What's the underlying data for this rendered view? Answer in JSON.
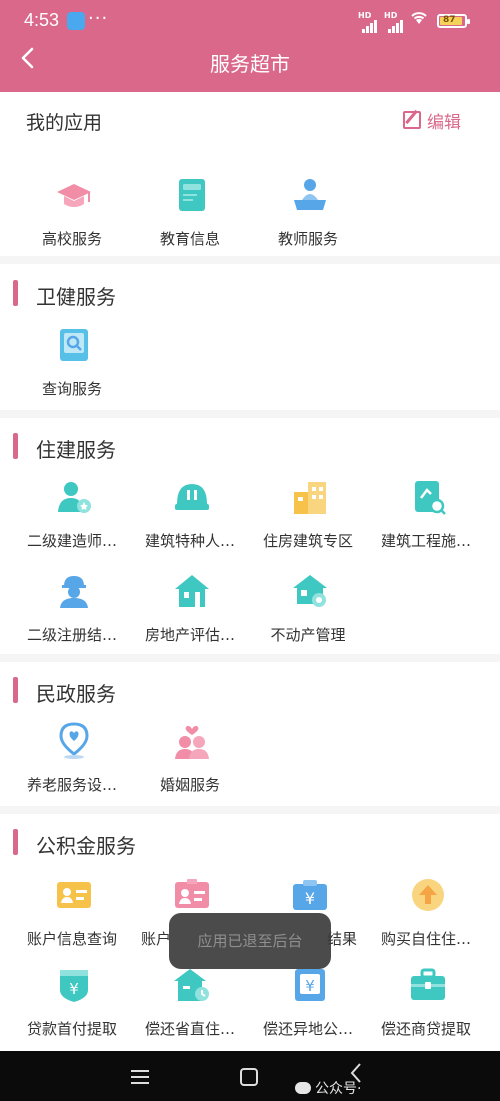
{
  "status_bar": {
    "time": "4:53",
    "battery": "87"
  },
  "header": {
    "title": "服务超市"
  },
  "my_apps": {
    "title": "我的应用",
    "edit_label": "编辑",
    "items": [
      {
        "label": "高校服务",
        "icon": "graduation-cap-icon"
      },
      {
        "label": "教育信息",
        "icon": "book-icon"
      },
      {
        "label": "教师服务",
        "icon": "teacher-icon"
      }
    ]
  },
  "sections": [
    {
      "title": "卫健服务",
      "items": [
        {
          "label": "查询服务",
          "icon": "query-book-icon"
        }
      ]
    },
    {
      "title": "住建服务",
      "items": [
        {
          "label": "二级建造师…",
          "icon": "person-star-icon"
        },
        {
          "label": "建筑特种人…",
          "icon": "hard-hat-icon"
        },
        {
          "label": "住房建筑专区",
          "icon": "buildings-icon"
        },
        {
          "label": "建筑工程施…",
          "icon": "document-search-icon"
        },
        {
          "label": "二级注册结…",
          "icon": "worker-icon"
        },
        {
          "label": "房地产评估…",
          "icon": "house-icon"
        },
        {
          "label": "不动产管理",
          "icon": "house-gear-icon"
        }
      ]
    },
    {
      "title": "民政服务",
      "items": [
        {
          "label": "养老服务设…",
          "icon": "location-heart-icon"
        },
        {
          "label": "婚姻服务",
          "icon": "couple-icon"
        }
      ]
    },
    {
      "title": "公积金服务",
      "items": [
        {
          "label": "账户信息查询",
          "icon": "id-card-icon"
        },
        {
          "label": "账户",
          "icon": "id-card-pink-icon"
        },
        {
          "label": "结果",
          "icon": "yen-folder-icon"
        },
        {
          "label": "购买自住住…",
          "icon": "upload-arrow-icon"
        },
        {
          "label": "贷款首付提取",
          "icon": "yen-badge-icon"
        },
        {
          "label": "偿还省直住…",
          "icon": "house-clock-icon"
        },
        {
          "label": "偿还异地公…",
          "icon": "yen-wallet-icon"
        },
        {
          "label": "偿还商贷提取",
          "icon": "briefcase-icon"
        }
      ]
    }
  ],
  "toast": {
    "text": "应用已退至后台"
  },
  "watermark": {
    "text": "公众号·"
  },
  "colors": {
    "accent": "#d9688b",
    "cyan": "#3fc7c1",
    "blue": "#57a6e8",
    "yellow": "#f6c24a",
    "pink": "#f28da7"
  }
}
